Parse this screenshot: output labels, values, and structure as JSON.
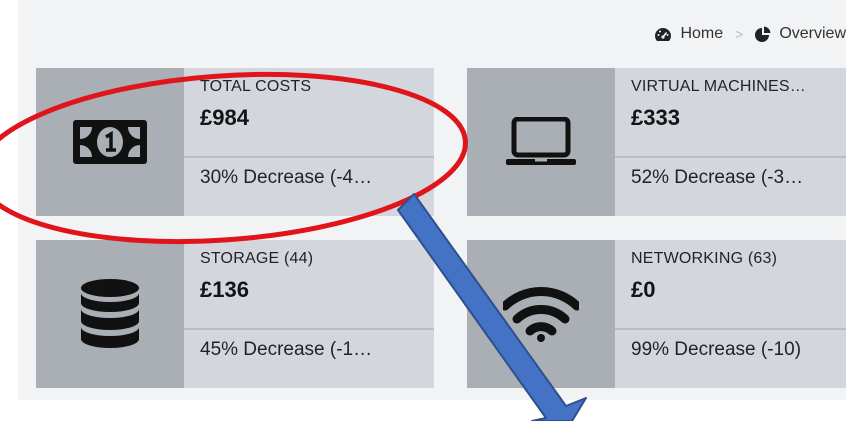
{
  "breadcrumb": {
    "home_label": "Home",
    "separator": ">",
    "overview_label": "Overview",
    "home_icon": "dashboard-icon",
    "overview_icon": "pie-chart-icon"
  },
  "cards": [
    {
      "title": "TOTAL COSTS",
      "amount": "£984",
      "change": "30% Decrease (-4…",
      "icon": "banknote-icon"
    },
    {
      "title": "VIRTUAL MACHINES…",
      "amount": "£333",
      "change": "52% Decrease (-3…",
      "icon": "laptop-icon"
    },
    {
      "title": "STORAGE (44)",
      "amount": "£136",
      "change": "45% Decrease (-1…",
      "icon": "database-icon"
    },
    {
      "title": "NETWORKING (63)",
      "amount": "£0",
      "change": "99% Decrease (-10)",
      "icon": "wifi-icon"
    }
  ],
  "annotations": {
    "ellipse_color": "#e0151b",
    "arrow_fill": "#4472c4",
    "arrow_stroke": "#2f4f8f"
  },
  "colors": {
    "panel_bg": "#f2f3f5",
    "card_bg": "#d3d6dd",
    "icon_bg": "#aaaeb5"
  }
}
